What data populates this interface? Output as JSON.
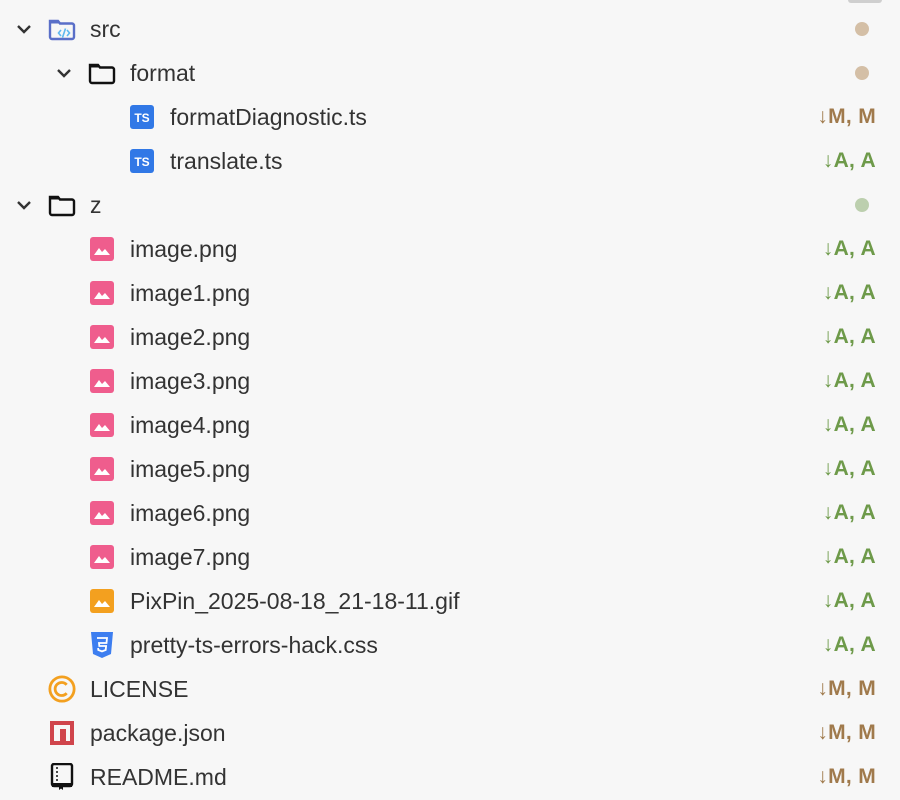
{
  "colors": {
    "modified": "#a07a4c",
    "added": "#6e9a4a",
    "dot_modified": "#d4bfa6",
    "dot_added": "#bccfae"
  },
  "tree": [
    {
      "label": "src",
      "level": 0,
      "type": "folder-src",
      "expanded": true,
      "dot": "modified"
    },
    {
      "label": "format",
      "level": 1,
      "type": "folder",
      "expanded": true,
      "dot": "modified"
    },
    {
      "label": "formatDiagnostic.ts",
      "level": 2,
      "type": "ts",
      "status": "↓M, M",
      "kind": "modified"
    },
    {
      "label": "translate.ts",
      "level": 2,
      "type": "ts",
      "status": "↓A, A",
      "kind": "added"
    },
    {
      "label": "z",
      "level": 0,
      "type": "folder",
      "expanded": true,
      "dot": "added"
    },
    {
      "label": "image.png",
      "level": 1,
      "type": "png",
      "status": "↓A, A",
      "kind": "added"
    },
    {
      "label": "image1.png",
      "level": 1,
      "type": "png",
      "status": "↓A, A",
      "kind": "added"
    },
    {
      "label": "image2.png",
      "level": 1,
      "type": "png",
      "status": "↓A, A",
      "kind": "added"
    },
    {
      "label": "image3.png",
      "level": 1,
      "type": "png",
      "status": "↓A, A",
      "kind": "added"
    },
    {
      "label": "image4.png",
      "level": 1,
      "type": "png",
      "status": "↓A, A",
      "kind": "added"
    },
    {
      "label": "image5.png",
      "level": 1,
      "type": "png",
      "status": "↓A, A",
      "kind": "added"
    },
    {
      "label": "image6.png",
      "level": 1,
      "type": "png",
      "status": "↓A, A",
      "kind": "added"
    },
    {
      "label": "image7.png",
      "level": 1,
      "type": "png",
      "status": "↓A, A",
      "kind": "added"
    },
    {
      "label": "PixPin_2025-08-18_21-18-11.gif",
      "level": 1,
      "type": "gif",
      "status": "↓A, A",
      "kind": "added"
    },
    {
      "label": "pretty-ts-errors-hack.css",
      "level": 1,
      "type": "css",
      "status": "↓A, A",
      "kind": "added"
    },
    {
      "label": "LICENSE",
      "level": 0,
      "type": "license",
      "status": "↓M, M",
      "kind": "modified"
    },
    {
      "label": "package.json",
      "level": 0,
      "type": "npm",
      "status": "↓M, M",
      "kind": "modified"
    },
    {
      "label": "README.md",
      "level": 0,
      "type": "readme",
      "status": "↓M, M",
      "kind": "modified"
    }
  ]
}
